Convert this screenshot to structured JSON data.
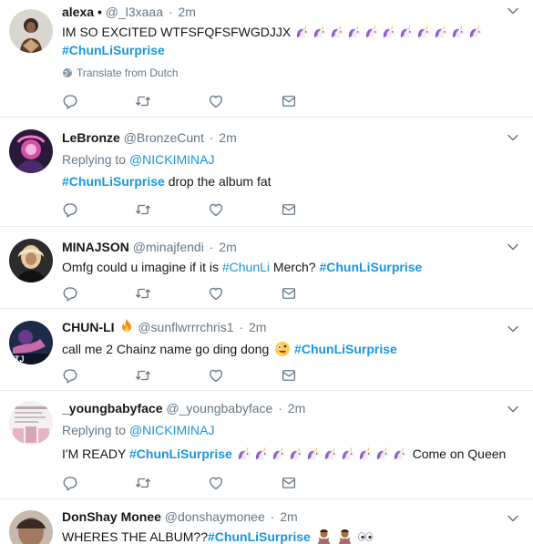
{
  "tweets": [
    {
      "name": "alexa",
      "badge": "•",
      "handle": "@_l3xaaa",
      "time": "2m",
      "line1": "IM SO EXCITED WTFSFQFSFWGDJJX",
      "line1_emoji": [
        "unicorn",
        "unicorn",
        "unicorn",
        "unicorn",
        "unicorn",
        "unicorn",
        "unicorn",
        "unicorn",
        "unicorn",
        "unicorn",
        "unicorn"
      ],
      "hashtag": "#ChunLiSurprise",
      "translate": "Translate from Dutch"
    },
    {
      "name": "LeBronze",
      "handle": "@BronzeCunt",
      "time": "2m",
      "reply_prefix": "Replying to",
      "reply_to": "@NICKIMINAJ",
      "hashtag": "#ChunLiSurprise",
      "text": "drop the album fat"
    },
    {
      "name": "MINAJSON",
      "handle": "@minajfendi",
      "time": "2m",
      "text": "Omfg could u imagine if it is",
      "hashtag1": "#ChunLi",
      "text2": "Merch?",
      "hashtag2": "#ChunLiSurprise"
    },
    {
      "name": "CHUN-LI",
      "name_emoji": "fire",
      "handle": "@sunflwrrrchris1",
      "time": "2m",
      "text": "call me 2 Chainz name go ding dong",
      "text_emoji": "zany-face",
      "hashtag": "#ChunLiSurprise"
    },
    {
      "name": "_youngbabyface",
      "handle": "@_youngbabyface",
      "time": "2m",
      "reply_prefix": "Replying to",
      "reply_to": "@NICKIMINAJ",
      "text": "I'M READY",
      "hashtag": "#ChunLiSurprise",
      "text_emoji": [
        "unicorn",
        "unicorn",
        "unicorn",
        "unicorn",
        "unicorn",
        "unicorn",
        "unicorn",
        "unicorn",
        "unicorn",
        "unicorn"
      ],
      "text2": "Come on Queen"
    },
    {
      "name": "DonShay Monee",
      "handle": "@donshaymonee",
      "time": "2m",
      "text": "WHERES THE ALBUM??",
      "hashtag": "#ChunLiSurprise",
      "text_emoji": [
        "person-gesturing-no",
        "person-gesturing-no",
        "eyes"
      ]
    }
  ],
  "colors": {
    "link": "#1b95e0",
    "muted": "#657786",
    "border": "#e6ecf0",
    "text": "#14171a",
    "unicorn": "#8b5cc7"
  },
  "icons": {
    "reply": "reply-icon",
    "retweet": "retweet-icon",
    "like": "heart-icon",
    "message": "envelope-icon",
    "caret": "chevron-down-icon",
    "globe": "globe-icon"
  }
}
